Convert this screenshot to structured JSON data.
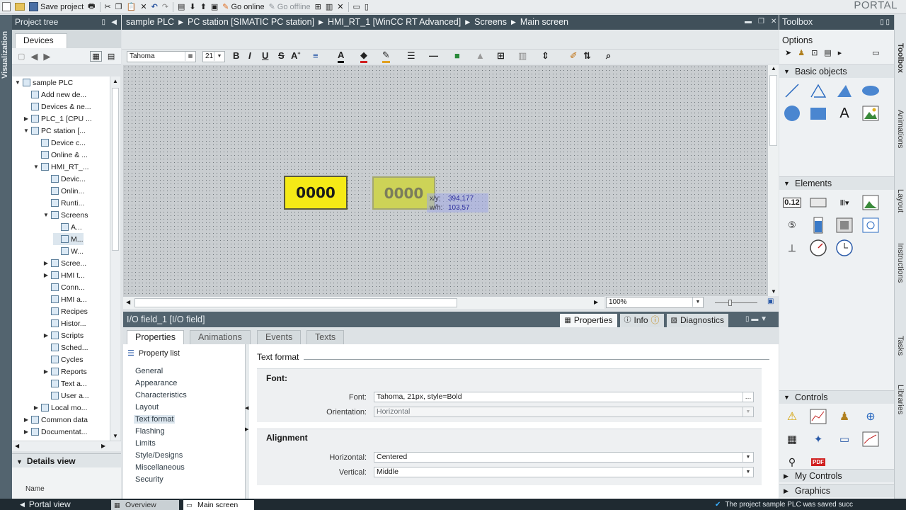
{
  "app_name": "PORTAL",
  "top_toolbar": {
    "save_label": "Save project",
    "go_online": "Go online",
    "go_offline": "Go offline"
  },
  "left_panel": {
    "title": "Project tree",
    "vertical_tab": "Visualization",
    "devices_tab": "Devices",
    "tree": [
      {
        "label": "sample PLC",
        "level": 0,
        "exp": "▼"
      },
      {
        "label": "Add new de...",
        "level": 1,
        "exp": ""
      },
      {
        "label": "Devices & ne...",
        "level": 1,
        "exp": ""
      },
      {
        "label": "PLC_1 [CPU ...",
        "level": 1,
        "exp": "▶"
      },
      {
        "label": "PC station [...",
        "level": 1,
        "exp": "▼"
      },
      {
        "label": "Device c...",
        "level": 2,
        "exp": ""
      },
      {
        "label": "Online & ...",
        "level": 2,
        "exp": ""
      },
      {
        "label": "HMI_RT_...",
        "level": 2,
        "exp": "▼"
      },
      {
        "label": "Devic...",
        "level": 3,
        "exp": ""
      },
      {
        "label": "Onlin...",
        "level": 3,
        "exp": ""
      },
      {
        "label": "Runti...",
        "level": 3,
        "exp": ""
      },
      {
        "label": "Screens",
        "level": 3,
        "exp": "▼"
      },
      {
        "label": "A...",
        "level": 4,
        "exp": ""
      },
      {
        "label": "M...",
        "level": 4,
        "exp": "",
        "selected": true
      },
      {
        "label": "W...",
        "level": 4,
        "exp": ""
      },
      {
        "label": "Scree...",
        "level": 3,
        "exp": "▶"
      },
      {
        "label": "HMI t...",
        "level": 3,
        "exp": "▶"
      },
      {
        "label": "Conn...",
        "level": 3,
        "exp": ""
      },
      {
        "label": "HMI a...",
        "level": 3,
        "exp": ""
      },
      {
        "label": "Recipes",
        "level": 3,
        "exp": ""
      },
      {
        "label": "Histor...",
        "level": 3,
        "exp": ""
      },
      {
        "label": "Scripts",
        "level": 3,
        "exp": "▶"
      },
      {
        "label": "Sched...",
        "level": 3,
        "exp": ""
      },
      {
        "label": "Cycles",
        "level": 3,
        "exp": ""
      },
      {
        "label": "Reports",
        "level": 3,
        "exp": "▶"
      },
      {
        "label": "Text a...",
        "level": 3,
        "exp": ""
      },
      {
        "label": "User a...",
        "level": 3,
        "exp": ""
      },
      {
        "label": "Local mo...",
        "level": 2,
        "exp": "▶"
      },
      {
        "label": "Common data",
        "level": 1,
        "exp": "▶"
      },
      {
        "label": "Documentat...",
        "level": 1,
        "exp": "▶"
      }
    ],
    "details_title": "Details view",
    "details_col": "Name"
  },
  "breadcrumb": [
    "sample PLC",
    "PC station [SIMATIC PC station]",
    "HMI_RT_1 [WinCC RT Advanced]",
    "Screens",
    "Main screen"
  ],
  "format_bar": {
    "font": "Tahoma",
    "size": "21"
  },
  "canvas": {
    "io_field_1": "0000",
    "io_field_2": "0000",
    "tooltip": {
      "xy_label": "x/y:",
      "xy_value": "394,177",
      "wh_label": "w/h:",
      "wh_value": "103,57"
    },
    "zoom": "100%"
  },
  "inspector": {
    "title": "I/O field_1 [I/O field]",
    "right_tabs": [
      "Properties",
      "Info",
      "Diagnostics"
    ],
    "tabs": [
      "Properties",
      "Animations",
      "Events",
      "Texts"
    ],
    "property_list": "Property list",
    "nav": [
      "General",
      "Appearance",
      "Characteristics",
      "Layout",
      "Text format",
      "Flashing",
      "Limits",
      "Style/Designs",
      "Miscellaneous",
      "Security"
    ],
    "section": "Text format",
    "font_group": {
      "title": "Font:",
      "font_label": "Font:",
      "font_value": "Tahoma, 21px, style=Bold",
      "orientation_label": "Orientation:",
      "orientation_value": "Horizontal"
    },
    "alignment_group": {
      "title": "Alignment",
      "horizontal_label": "Horizontal:",
      "horizontal_value": "Centered",
      "vertical_label": "Vertical:",
      "vertical_value": "Middle"
    }
  },
  "toolbox": {
    "title": "Toolbox",
    "options": "Options",
    "basic_objects": "Basic objects",
    "text_tool": "A",
    "elements": "Elements",
    "io_tool": "0.12",
    "controls": "Controls",
    "pdf_tool": "PDF",
    "my_controls": "My Controls",
    "graphics": "Graphics",
    "vertical_tabs": [
      "Toolbox",
      "Animations",
      "Layout",
      "Instructions",
      "Tasks",
      "Libraries"
    ]
  },
  "taskbar": {
    "portal_view": "Portal view",
    "overview": "Overview",
    "main_screen": "Main screen",
    "status": "The project sample PLC was saved succ"
  },
  "colors": {
    "io_yellow": "#f5ea16",
    "header_dark": "#40505a",
    "taskbar": "#1f2a31"
  }
}
